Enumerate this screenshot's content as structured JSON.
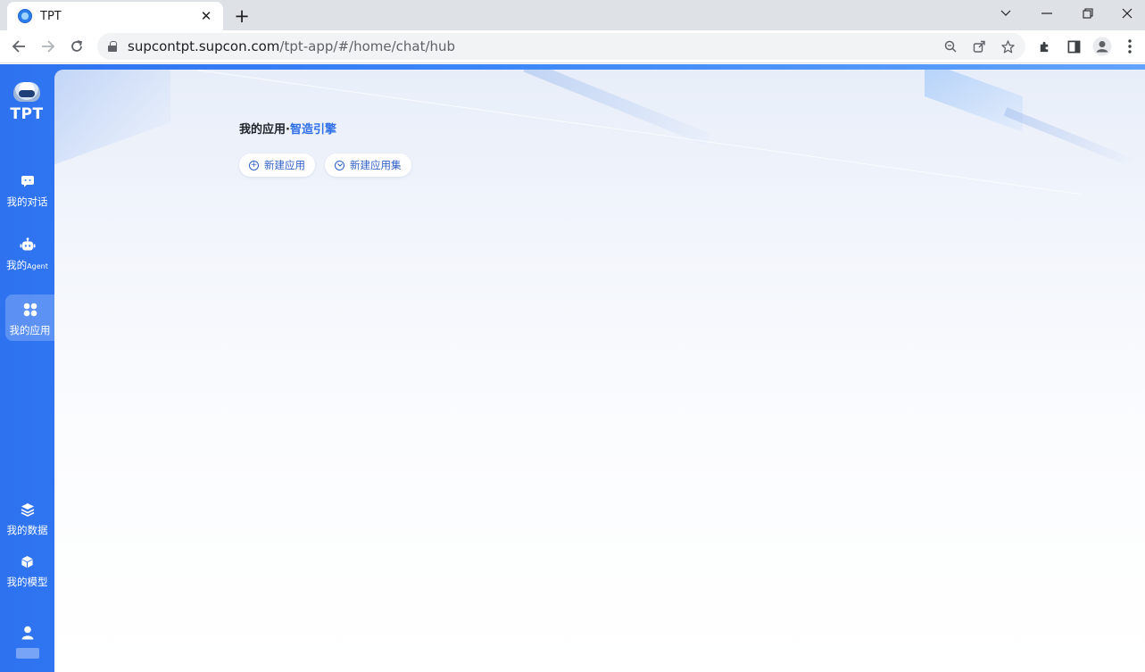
{
  "browser": {
    "tab_title": "TPT",
    "url_domain": "supcontpt.supcon.com",
    "url_path": "/tpt-app/#/home/chat/hub"
  },
  "app": {
    "logo_text": "TPT",
    "nav": [
      {
        "label": "我的对话",
        "icon": "chat-bubble-icon"
      },
      {
        "label_main": "我的",
        "label_small": "Agent",
        "icon": "robot-icon"
      },
      {
        "label": "我的应用",
        "icon": "apps-grid-icon",
        "active": true
      },
      {
        "label": "我的数据",
        "icon": "layers-icon"
      },
      {
        "label": "我的模型",
        "icon": "cube-icon"
      }
    ],
    "user_icon": "user-avatar-icon"
  },
  "main": {
    "title_prefix": "我的应用·",
    "title_highlight": "智造引擎",
    "buttons": [
      {
        "label": "新建应用",
        "icon": "plus-circle-icon"
      },
      {
        "label": "新建应用集",
        "icon": "chevron-circle-icon"
      }
    ]
  },
  "colors": {
    "sidebar_blue": "#3a85f7",
    "accent": "#2f6fe8"
  }
}
